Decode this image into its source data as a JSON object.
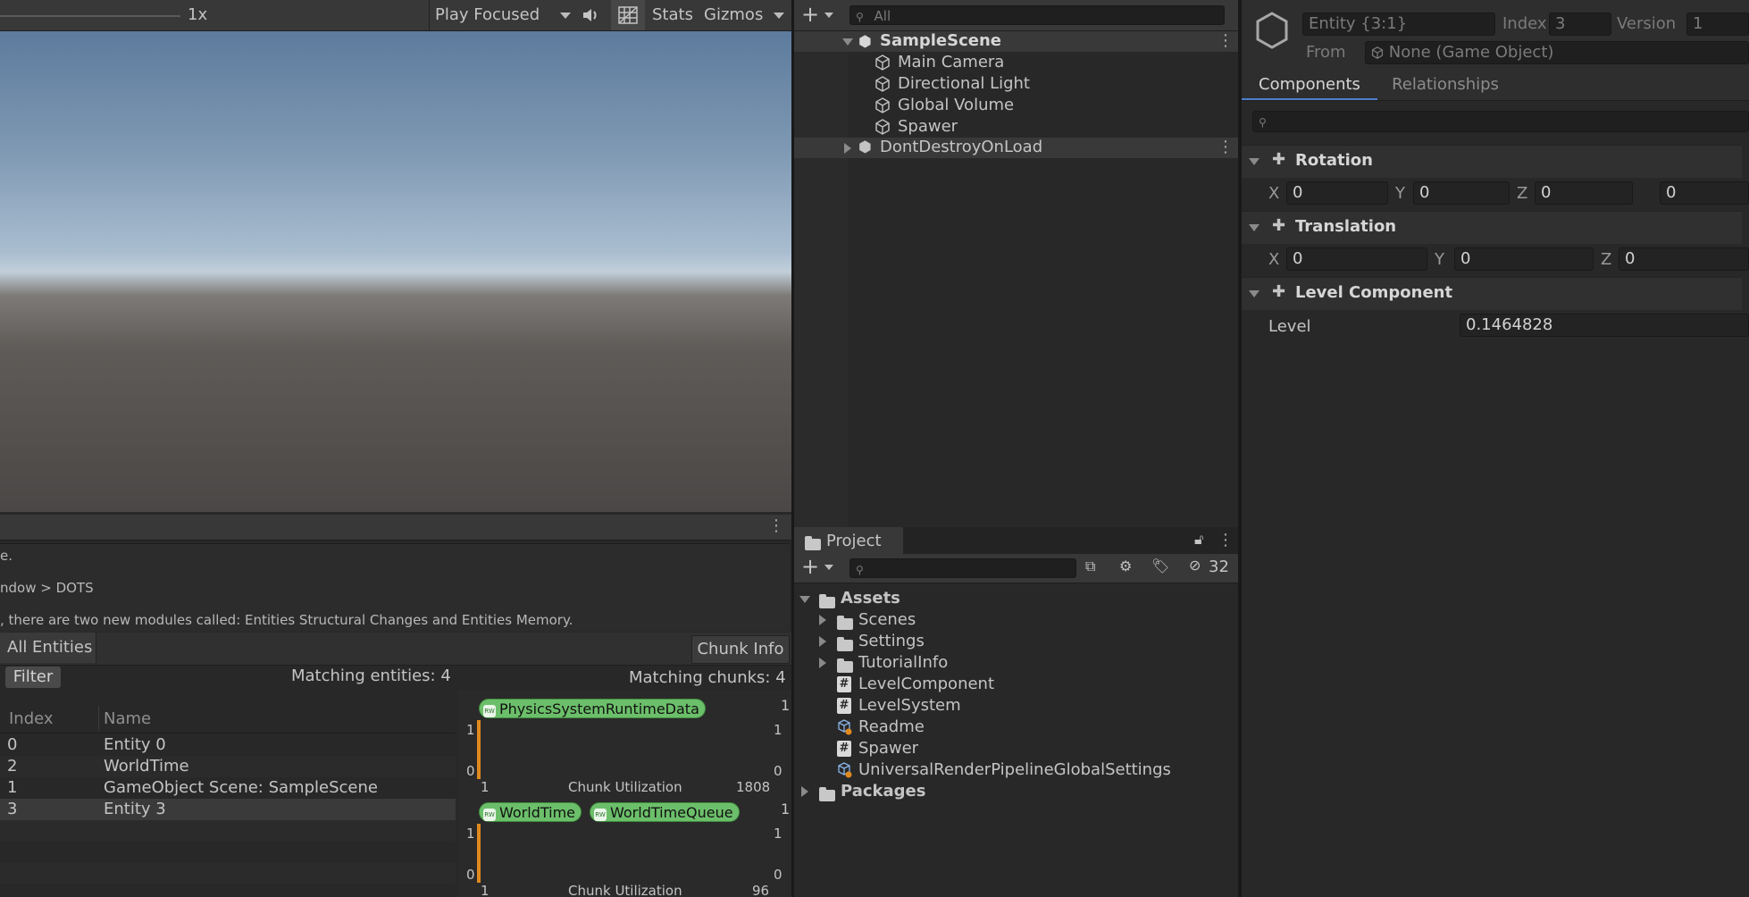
{
  "game": {
    "scale_label": "1x",
    "play_mode": "Play Focused",
    "stats": "Stats",
    "gizmos": "Gizmos"
  },
  "console": {
    "lines": [
      "e.",
      "ndow > DOTS",
      ", there are two new modules called: Entities Structural Changes and Entities Memory."
    ]
  },
  "entities": {
    "tab_all": "All Entities",
    "tab_chunk": "Chunk Info",
    "filter": "Filter",
    "matching_entities": "Matching entities: 4",
    "matching_chunks": "Matching chunks: 4",
    "col_index": "Index",
    "col_name": "Name",
    "rows": [
      {
        "index": "0",
        "name": "Entity 0"
      },
      {
        "index": "2",
        "name": "WorldTime"
      },
      {
        "index": "1",
        "name": "GameObject Scene: SampleScene"
      },
      {
        "index": "3",
        "name": "Entity 3"
      }
    ],
    "chunks": [
      {
        "components": [
          "PhysicsSystemRuntimeData"
        ],
        "count": "1",
        "axis_top": "1",
        "axis_bottom": "0",
        "right_top": "1",
        "right_bottom": "0",
        "x_start": "1",
        "label": "Chunk Utilization",
        "capacity": "1808"
      },
      {
        "components": [
          "WorldTime",
          "WorldTimeQueue"
        ],
        "count": "1",
        "axis_top": "1",
        "axis_bottom": "0",
        "right_top": "1",
        "right_bottom": "0",
        "x_start": "1",
        "label": "Chunk Utilization",
        "capacity": "96"
      }
    ],
    "rw_badge": "RW"
  },
  "hierarchy": {
    "search_placeholder": "All",
    "scene": "SampleScene",
    "children": [
      "Main Camera",
      "Directional Light",
      "Global Volume",
      "Spawer"
    ],
    "dont_destroy": "DontDestroyOnLoad"
  },
  "project": {
    "tab": "Project",
    "hidden_count": "32",
    "assets": "Assets",
    "folders": [
      "Scenes",
      "Settings",
      "TutorialInfo"
    ],
    "files": [
      {
        "name": "LevelComponent",
        "icon": "script-icon"
      },
      {
        "name": "LevelSystem",
        "icon": "script-icon"
      },
      {
        "name": "Readme",
        "icon": "asset-icon"
      },
      {
        "name": "Spawer",
        "icon": "script-icon"
      },
      {
        "name": "UniversalRenderPipelineGlobalSettings",
        "icon": "asset-icon"
      }
    ],
    "packages": "Packages"
  },
  "inspector": {
    "entity": "Entity {3:1}",
    "index_label": "Index",
    "index_value": "3",
    "version_label": "Version",
    "version_value": "1",
    "from_label": "From",
    "from_value": "None (Game Object)",
    "tab_components": "Components",
    "tab_relationships": "Relationships",
    "rotation": {
      "title": "Rotation",
      "x": "0",
      "y": "0",
      "z": "0",
      "w": "0"
    },
    "translation": {
      "title": "Translation",
      "x": "0",
      "y": "0",
      "z": "0"
    },
    "level_component": {
      "title": "Level Component",
      "label": "Level",
      "value": "0.1464828"
    },
    "axis_x": "X",
    "axis_y": "Y",
    "axis_z": "Z"
  },
  "colors": {
    "accent_tab": "#4c7fcf",
    "pill_green": "#6cbf6a",
    "chart_bar": "#e08a1e"
  }
}
